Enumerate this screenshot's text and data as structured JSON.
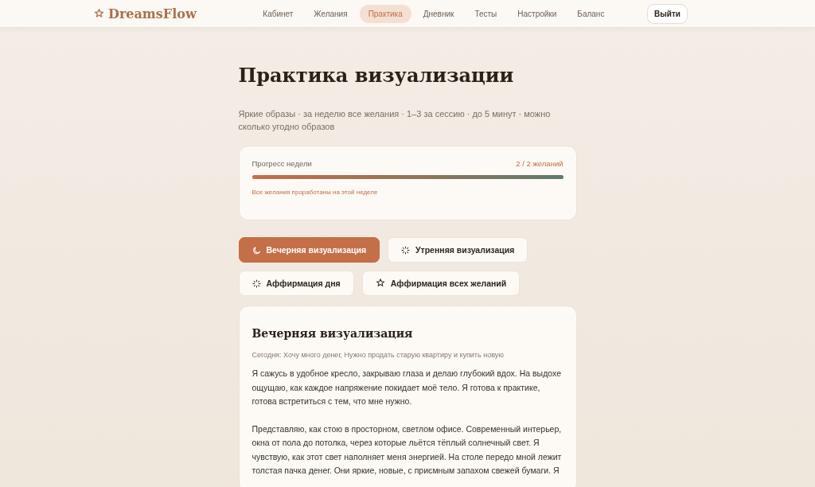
{
  "header": {
    "logo": "DreamsFlow",
    "nav": [
      {
        "label": "Кабинет",
        "selected": false
      },
      {
        "label": "Желания",
        "selected": false
      },
      {
        "label": "Практика",
        "selected": true
      },
      {
        "label": "Дневник",
        "selected": false
      },
      {
        "label": "Тесты",
        "selected": false
      },
      {
        "label": "Настройки",
        "selected": false
      },
      {
        "label": "Баланс",
        "selected": false
      }
    ],
    "logout": "Выйти"
  },
  "title": "Практика визуализации",
  "subtitle": "Яркие образы · за неделю все желания · 1–3 за сессию · до 5 минут · можно сколько угодно образов",
  "progress": {
    "label": "Прогресс недели",
    "count": "2 / 2 желаний",
    "level": 1,
    "note": "Все желания проработаны на этой неделе"
  },
  "modes": [
    {
      "label": "Вечерняя визуализация",
      "kind": "moon",
      "selected": true
    },
    {
      "label": "Утренняя визуализация",
      "kind": "sparkle",
      "selected": false
    },
    {
      "label": "Аффирмация дня",
      "kind": "sparkle",
      "selected": false
    },
    {
      "label": "Аффирмация всех желаний",
      "kind": "star",
      "selected": false
    }
  ],
  "session": {
    "title": "Вечерняя визуализация",
    "today": "Сегодня: Хочу много денег, Нужно продать старую квартиру и купить новую",
    "paragraphs": [
      "Я сажусь в удобное кресло, закрываю глаза и делаю глубокий вдох. На выдохе ощущаю, как каждое напряжение покидает моё тело. Я готова к практике, готова встретиться с тем, что мне нужно.",
      "Представляю, как стою в просторном, светлом офисе. Современный интерьер, окна от пола до потолка, через которые льётся тёплый солнечный свет. Я чувствую, как этот свет наполняет меня энергией. На столе передо мной лежит толстая пачка денег. Они яркие, новые, с приємным запахом свежей бумаги. Я"
    ]
  }
}
